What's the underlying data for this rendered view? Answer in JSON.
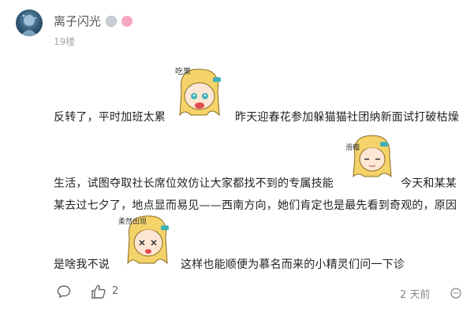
{
  "comment": {
    "username": "离子闪光",
    "floor": "19楼",
    "lines": [
      "反转了，平时加班太累",
      "昨天迎春花参加躲猫猫社团纳新面试打破枯燥",
      "生活，试图夺取社长席位效仿让大家都找不到的专属技能",
      "今天和某某",
      "某去过七夕了，地点显而易见——西南方向，她们肯定也是最先看到奇观的，原因",
      "是啥我不说",
      "这样也能顺便为慕名而来的小精灵们问一下诊"
    ],
    "stickers": [
      {
        "name": "sticker-eating",
        "caption": "吃果"
      },
      {
        "name": "sticker-slip",
        "caption": "滑稽"
      },
      {
        "name": "sticker-dizzy",
        "caption": "柔然出现"
      }
    ],
    "like_count": "2",
    "time": "2 天前"
  }
}
